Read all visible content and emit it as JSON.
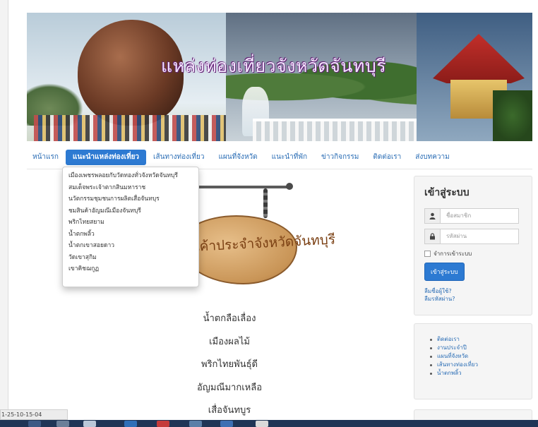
{
  "banner": {
    "title": "แหล่งท่องเที่ยวจังหวัดจันทบุรี"
  },
  "nav": {
    "items": [
      {
        "label": "หน้าแรก"
      },
      {
        "label": "แนะนำแหล่งท่องเที่ยว",
        "active": true
      },
      {
        "label": "เส้นทางท่องเที่ยว"
      },
      {
        "label": "แผนที่จังหวัด"
      },
      {
        "label": "แนะนำที่พัก"
      },
      {
        "label": "ข่าวกิจกรรม"
      },
      {
        "label": "ติดต่อเรา"
      },
      {
        "label": "ส่งบทความ"
      }
    ]
  },
  "dropdown": {
    "items": [
      "เมืองเพชรพลอยกับวัดทองทั่วจังหวัดจันทบุรี",
      "สมเด็จพระเจ้าตากสินมหาราช",
      "นวัตกรรมชุมชนการผลิตเสื่อจันทบุร",
      "ชมสินค้าอัญมณีเมืองจันทบุรี",
      "พริกไทยสยาม",
      "น้ำตกพลิ้ว",
      "น้ำตกเขาสอยดาว",
      "วัดเขาสุกิม",
      "เขาคิชฌกูฏ"
    ]
  },
  "sign": {
    "text": "สินค้าประจำจังหวัดจันทบุรี"
  },
  "products": [
    "น้ำตกลือเลื่อง",
    "เมืองผลไม้",
    "พริกไทยพันธุ์ดี",
    "อัญมณีมากเหลือ",
    "เสื่อจันทบูร"
  ],
  "login": {
    "title": "เข้าสู่ระบบ",
    "username_placeholder": "ชื่อสมาชิก",
    "password_placeholder": "รหัสผ่าน",
    "remember_label": "จำการเข้าระบบ",
    "button_label": "เข้าสู่ระบบ",
    "forgot_username": "ลืมชื่อผู้ใช้?",
    "forgot_password": "ลืมรหัสผ่าน?"
  },
  "links": {
    "items": [
      "ติดต่อเรา",
      "งานประจำปี",
      "แผนที่จังหวัด",
      "เส้นทางท่องเที่ยว",
      "น้ำตกพลิ้ว"
    ]
  },
  "status": {
    "text": "1-25-10-15-04"
  },
  "colors": {
    "accent": "#2d7ad2",
    "link": "#2a6db5",
    "taskbar": "#1f3556"
  }
}
